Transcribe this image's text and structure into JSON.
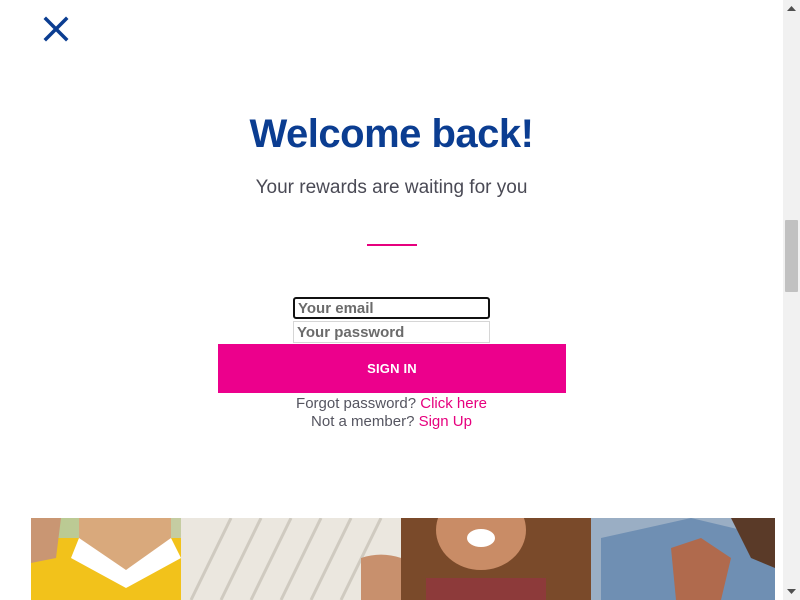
{
  "close_button": {
    "icon": "close-icon",
    "color": "#0b3d91"
  },
  "header": {
    "title": "Welcome back!",
    "subtitle": "Your rewards are waiting for you"
  },
  "form": {
    "email_placeholder": "Your email",
    "password_placeholder": "Your password",
    "signin_label": "SIGN IN"
  },
  "links": {
    "forgot_text": "Forgot password?",
    "forgot_link": "Click here",
    "member_text": "Not a member?",
    "member_link": "Sign Up"
  },
  "hero_image": {
    "icon": "hero-photo-group-of-people"
  },
  "colors": {
    "brand_blue": "#0b3d91",
    "accent_pink": "#ec008c",
    "text_gray": "#555560"
  }
}
